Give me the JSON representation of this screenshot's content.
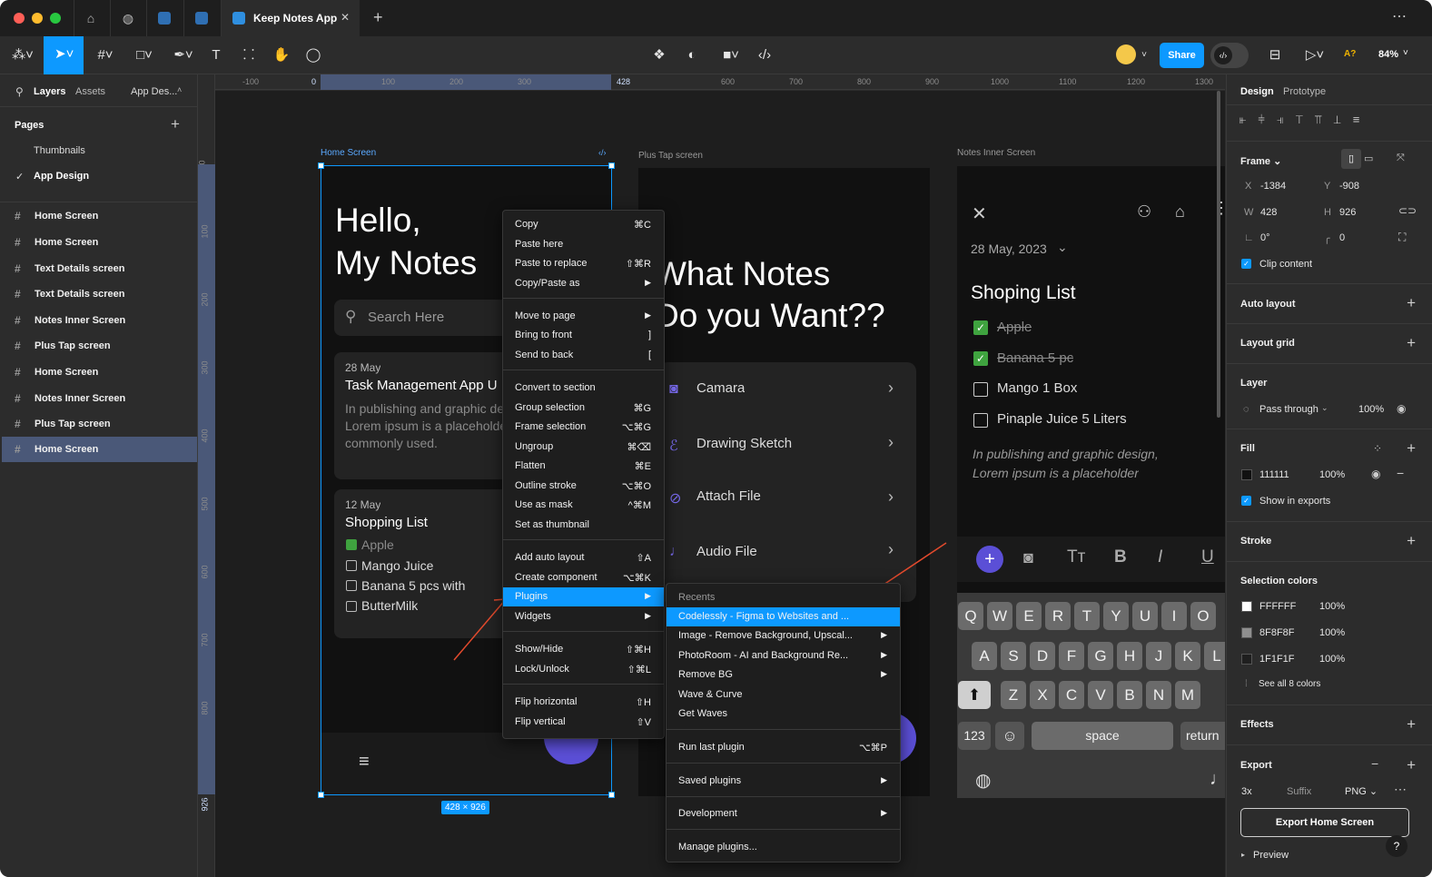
{
  "tab": {
    "title": "Keep Notes App",
    "close": "✕",
    "add": "+",
    "more": "⋯"
  },
  "toolbar": {
    "share_label": "Share",
    "zoom": "84%",
    "a_label": "A?"
  },
  "left": {
    "tabs": {
      "layers": "Layers",
      "assets": "Assets",
      "page": "App Des..."
    },
    "pages_title": "Pages",
    "pages": [
      "Thumbnails",
      "App Design"
    ],
    "layers": [
      "Home Screen",
      "Home Screen",
      "Text Details screen",
      "Text Details screen",
      "Notes Inner Screen",
      "Plus Tap screen",
      "Home Screen",
      "Notes Inner Screen",
      "Plus Tap screen",
      "Home Screen"
    ]
  },
  "ruler": {
    "h": [
      "-100",
      "0",
      "100",
      "200",
      "300",
      "428",
      "600",
      "700",
      "800",
      "900",
      "1000",
      "1100",
      "1200",
      "1300"
    ],
    "v": [
      "0",
      "100",
      "200",
      "300",
      "400",
      "500",
      "600",
      "700",
      "800",
      "926"
    ]
  },
  "frames": {
    "home_label": "Home Screen",
    "plus_label": "Plus Tap screen",
    "inner_label": "Notes Inner Screen",
    "size_badge": "428 × 926",
    "home": {
      "greeting_1": "Hello,",
      "greeting_2": "My Notes",
      "search": "Search Here",
      "card1": {
        "date": "28 May",
        "title": "Task Management App U",
        "body_1": "In publishing and graphic de",
        "body_2": "Lorem ipsum is a placeholde",
        "body_3": "commonly used."
      },
      "card2": {
        "date": "12 May",
        "title": "Shopping List",
        "items": [
          "Apple",
          "Mango Juice",
          "Banana 5 pcs with",
          "ButterMilk"
        ]
      }
    },
    "plus": {
      "title_1": "What Notes",
      "title_2": "Do you Want??",
      "options": [
        "Camara",
        "Drawing Sketch",
        "Attach File",
        "Audio File"
      ]
    },
    "inner": {
      "date": "28 May, 2023",
      "title": "Shoping List",
      "items": [
        "Apple",
        "Banana 5 pc",
        "Mango 1 Box",
        "Pinaple Juice 5 Liters"
      ],
      "hand_1": "In publishing and graphic design,",
      "hand_2": "Lorem ipsum is a placeholder",
      "kb_row1": [
        "Q",
        "W",
        "E",
        "R",
        "T",
        "Y",
        "U",
        "I",
        "O"
      ],
      "kb_row2": [
        "A",
        "S",
        "D",
        "F",
        "G",
        "H",
        "J",
        "K",
        "L"
      ],
      "kb_row3": [
        "Z",
        "X",
        "C",
        "V",
        "B",
        "N",
        "M"
      ],
      "kb_123": "123",
      "kb_space": "space",
      "kb_return": "return"
    }
  },
  "context_menu": [
    {
      "label": "Copy",
      "shortcut": "⌘C"
    },
    {
      "label": "Paste here",
      "shortcut": ""
    },
    {
      "label": "Paste to replace",
      "shortcut": "⇧⌘R"
    },
    {
      "label": "Copy/Paste as",
      "shortcut": "▶"
    },
    {
      "label": "Move to page",
      "shortcut": "▶"
    },
    {
      "label": "Bring to front",
      "shortcut": "]"
    },
    {
      "label": "Send to back",
      "shortcut": "["
    },
    {
      "label": "Convert to section",
      "shortcut": ""
    },
    {
      "label": "Group selection",
      "shortcut": "⌘G"
    },
    {
      "label": "Frame selection",
      "shortcut": "⌥⌘G"
    },
    {
      "label": "Ungroup",
      "shortcut": "⌘⌫"
    },
    {
      "label": "Flatten",
      "shortcut": "⌘E"
    },
    {
      "label": "Outline stroke",
      "shortcut": "⌥⌘O"
    },
    {
      "label": "Use as mask",
      "shortcut": "^⌘M"
    },
    {
      "label": "Set as thumbnail",
      "shortcut": ""
    },
    {
      "label": "Add auto layout",
      "shortcut": "⇧A"
    },
    {
      "label": "Create component",
      "shortcut": "⌥⌘K"
    },
    {
      "label": "Plugins",
      "shortcut": "▶"
    },
    {
      "label": "Widgets",
      "shortcut": "▶"
    },
    {
      "label": "Show/Hide",
      "shortcut": "⇧⌘H"
    },
    {
      "label": "Lock/Unlock",
      "shortcut": "⇧⌘L"
    },
    {
      "label": "Flip horizontal",
      "shortcut": "⇧H"
    },
    {
      "label": "Flip vertical",
      "shortcut": "⇧V"
    }
  ],
  "plugins_menu": {
    "recents_title": "Recents",
    "items": [
      {
        "label": "Codelessly - Figma to Websites and ...",
        "shortcut": ""
      },
      {
        "label": "Image - Remove Background, Upscal...",
        "shortcut": "▶"
      },
      {
        "label": "PhotoRoom - AI and Background Re...",
        "shortcut": "▶"
      },
      {
        "label": "Remove BG",
        "shortcut": "▶"
      },
      {
        "label": "Wave & Curve",
        "shortcut": ""
      },
      {
        "label": "Get Waves",
        "shortcut": ""
      },
      {
        "label": "Run last plugin",
        "shortcut": "⌥⌘P"
      },
      {
        "label": "Saved plugins",
        "shortcut": "▶"
      },
      {
        "label": "Development",
        "shortcut": "▶"
      },
      {
        "label": "Manage plugins...",
        "shortcut": ""
      }
    ]
  },
  "right": {
    "tabs": {
      "design": "Design",
      "prototype": "Prototype"
    },
    "frame": {
      "title": "Frame ⌄",
      "x_label": "X",
      "x": "-1384",
      "y_label": "Y",
      "y": "-908",
      "w_label": "W",
      "w": "428",
      "h_label": "H",
      "h": "926",
      "rot": "0°",
      "radius": "0",
      "clip": "Clip content"
    },
    "auto_layout": "Auto layout",
    "layout_grid": "Layout grid",
    "layer": {
      "title": "Layer",
      "blend": "Pass through",
      "opacity": "100%"
    },
    "fill": {
      "title": "Fill",
      "hex": "111111",
      "opacity": "100%",
      "show_exports": "Show in exports",
      "swatch": "#111111"
    },
    "stroke": "Stroke",
    "selection_colors": {
      "title": "Selection colors",
      "colors": [
        {
          "hex": "FFFFFF",
          "opacity": "100%",
          "swatch": "#FFFFFF"
        },
        {
          "hex": "8F8F8F",
          "opacity": "100%",
          "swatch": "#8F8F8F"
        },
        {
          "hex": "1F1F1F",
          "opacity": "100%",
          "swatch": "#1F1F1F"
        }
      ],
      "see_all": "See all 8 colors"
    },
    "effects": "Effects",
    "export": {
      "title": "Export",
      "scale": "3x",
      "suffix": "Suffix",
      "format": "PNG ⌄",
      "button": "Export Home Screen",
      "preview": "Preview"
    }
  },
  "colors": {
    "accent": "#0d99ff",
    "purple": "#5b4fd6",
    "highlight_blue": "#0d99ff"
  }
}
